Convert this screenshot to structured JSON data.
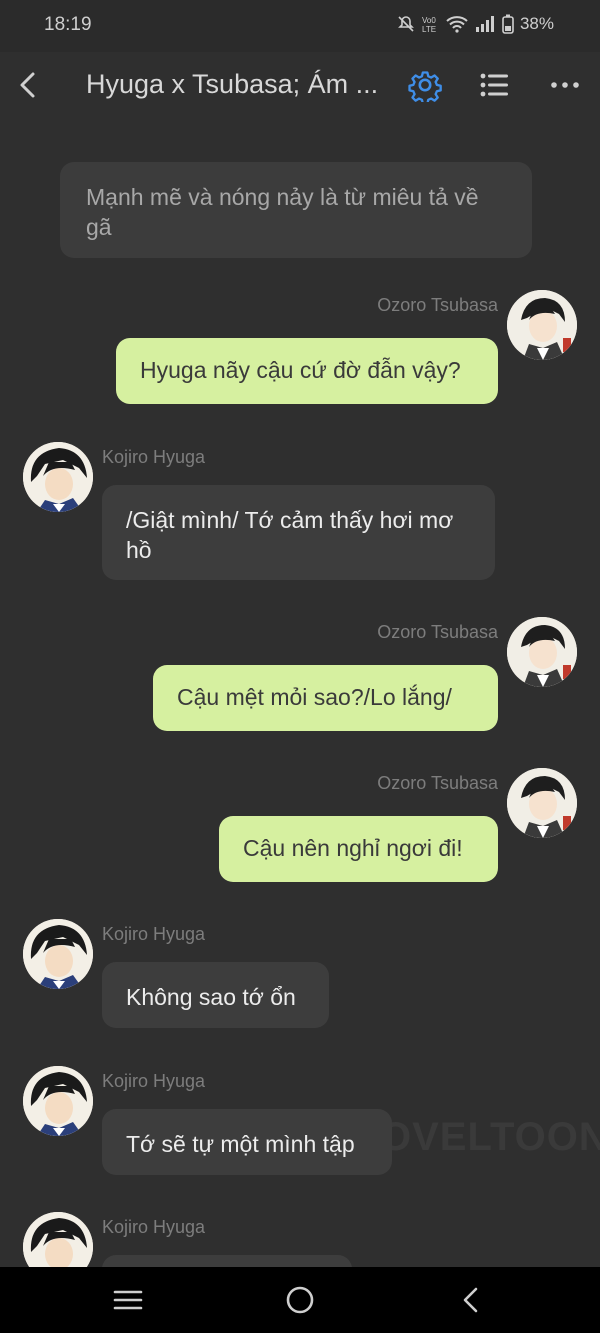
{
  "status_bar": {
    "time": "18:19",
    "battery": "38%"
  },
  "header": {
    "title": "Hyuga x Tsubasa; Ám ..."
  },
  "narration": "Mạnh mẽ và nóng nảy là từ miêu tả về gã",
  "messages": [
    {
      "sender": "Ozoro Tsubasa",
      "text": "Hyuga nãy cậu cứ đờ đẫn vậy?"
    },
    {
      "sender": "Kojiro Hyuga",
      "text": "/Giật mình/ Tớ cảm thấy hơi mơ hồ"
    },
    {
      "sender": "Ozoro Tsubasa",
      "text": "Cậu mệt mỏi sao?/Lo lắng/"
    },
    {
      "sender": "Ozoro Tsubasa",
      "text": "Cậu nên nghỉ ngơi đi!"
    },
    {
      "sender": "Kojiro Hyuga",
      "text": "Không sao tớ ổn"
    },
    {
      "sender": "Kojiro Hyuga",
      "text": "Tớ sẽ tự một mình tập"
    },
    {
      "sender": "Kojiro Hyuga",
      "text": ""
    }
  ],
  "watermark": "OVELTOON",
  "colors": {
    "background": "#2f2f2f",
    "outgoing_bubble": "#d6f0a0",
    "incoming_bubble": "#3d3d3d",
    "accent": "#3f8ee8"
  },
  "icons": [
    "back-arrow",
    "gear",
    "list",
    "more-dots",
    "menu",
    "home-circle",
    "back-chevron"
  ]
}
